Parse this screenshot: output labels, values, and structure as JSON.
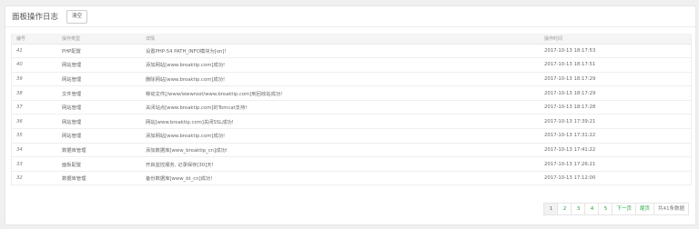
{
  "header": {
    "title": "面板操作日志",
    "clear_label": "清空"
  },
  "table": {
    "columns": [
      "编号",
      "操作类型",
      "详情",
      "操作时间"
    ],
    "rows": [
      {
        "id": "41",
        "type": "PHP配置",
        "detail": "设置PHP-54 PATH_INFO模块为[on]!",
        "time": "2017-10-13 18:17:53"
      },
      {
        "id": "40",
        "type": "网站管理",
        "detail": "添加网站[www.breaktip.com]成功!",
        "time": "2017-10-13 18:17:51"
      },
      {
        "id": "39",
        "type": "网站管理",
        "detail": "删除网站[www.breaktip.com]成功!",
        "time": "2017-10-13 18:17:29"
      },
      {
        "id": "38",
        "type": "文件管理",
        "detail": "移动文件[/www/wwwroot/www.breaktip.com]到回收站成功!",
        "time": "2017-10-13 18:17:29"
      },
      {
        "id": "37",
        "type": "网站管理",
        "detail": "关闭站点[www.breaktip.com]的Tomcat支持!",
        "time": "2017-10-13 18:17:28"
      },
      {
        "id": "36",
        "type": "网站管理",
        "detail": "网站[www.breaktip.com]关闭SSL成功!",
        "time": "2017-10-13 17:39:21"
      },
      {
        "id": "35",
        "type": "网站管理",
        "detail": "添加网站[www.breaktip.com]成功!",
        "time": "2017-10-13 17:31:22"
      },
      {
        "id": "34",
        "type": "数据库管理",
        "detail": "添加数据库[www_breaktip_cn]成功!",
        "time": "2017-10-13 17:41:22"
      },
      {
        "id": "33",
        "type": "面板配置",
        "detail": "开启监控服务, 记录保存[30]天!",
        "time": "2017-10-13 17:26:21"
      },
      {
        "id": "32",
        "type": "数据库管理",
        "detail": "备份数据库[www_bt_cn]成功!",
        "time": "2017-10-13 17:12:00"
      }
    ]
  },
  "pager": {
    "pages": [
      "1",
      "2",
      "3",
      "4",
      "5"
    ],
    "current": "1",
    "next_label": "下一页",
    "last_label": "尾页",
    "total_label": "共41条数据"
  },
  "colors": {
    "link": "#20a53a",
    "header_bg": "#f5f5f5"
  }
}
